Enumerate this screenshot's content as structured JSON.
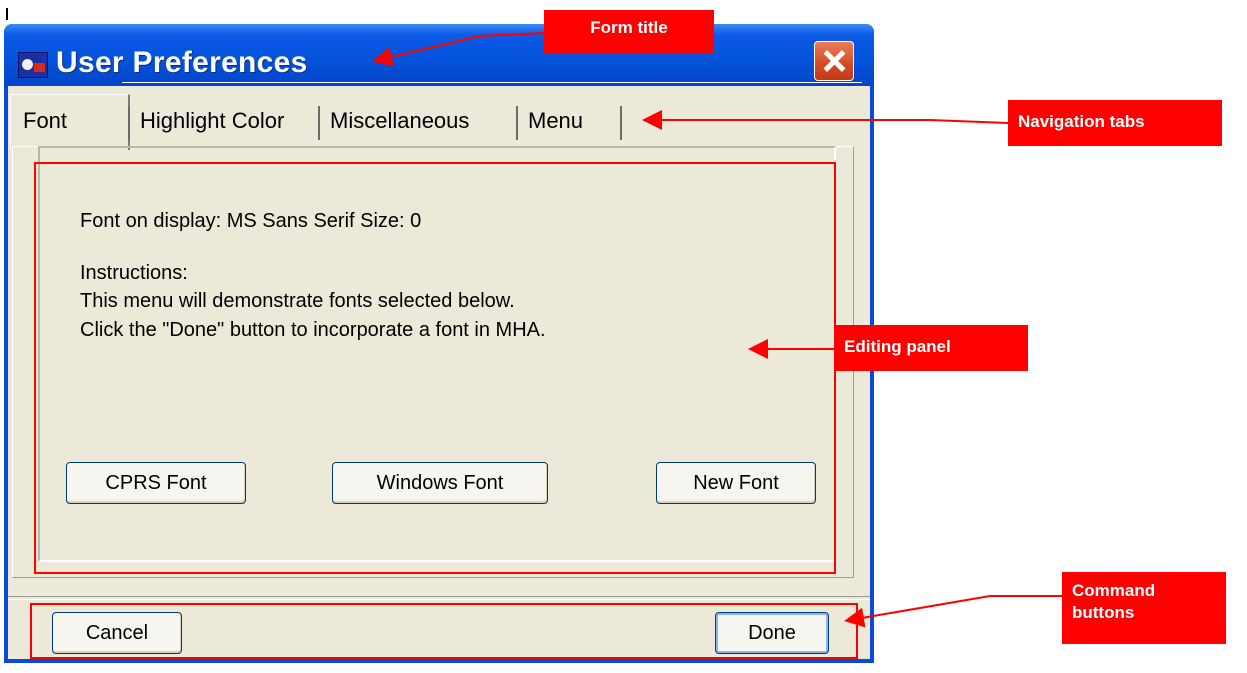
{
  "window": {
    "title": "User Preferences",
    "close_label": "Close"
  },
  "tabs": [
    {
      "label": "Font",
      "accesskey": "F",
      "active": true
    },
    {
      "label": "Highlight Color",
      "accesskey": "H",
      "active": false
    },
    {
      "label": "Miscellaneous",
      "accesskey": "M",
      "active": false
    },
    {
      "label": "Menu",
      "accesskey": "u",
      "active": false
    }
  ],
  "panel": {
    "font_info": "Font on display: MS Sans Serif   Size: 0",
    "instructions_heading": "Instructions:",
    "instructions_line1": "This menu will demonstrate fonts selected below.",
    "instructions_line2": "Click the \"Done\" button to incorporate a font in MHA."
  },
  "font_buttons": {
    "cprs": "CPRS Font",
    "windows": "Windows Font",
    "new": "New Font"
  },
  "commands": {
    "cancel": "Cancel",
    "done": "Done"
  },
  "annotations": {
    "form_title": "Form title",
    "navigation_tabs": "Navigation tabs",
    "editing_panel": "Editing panel",
    "command_buttons": "Command buttons",
    "color": "#ff0000"
  },
  "colors": {
    "titlebar": "#0453dc",
    "client_bg": "#ece9d8",
    "close_button": "#d44a22"
  }
}
